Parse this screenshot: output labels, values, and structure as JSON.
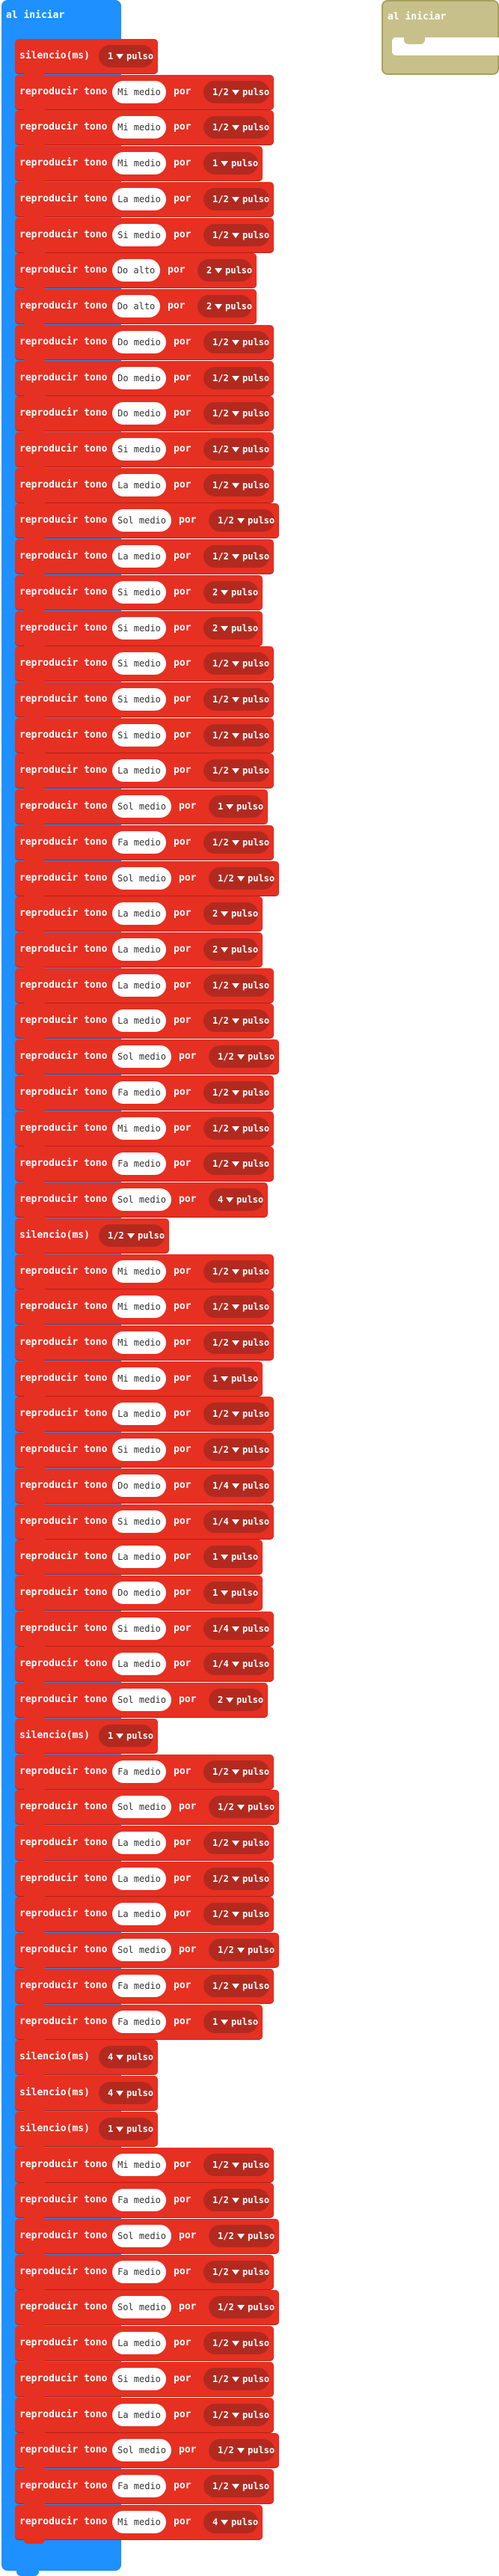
{
  "hat": {
    "title": "al iniciar"
  },
  "ghost": {
    "title": "al iniciar"
  },
  "labels": {
    "play": "reproducir tono",
    "por": "por",
    "rest": "silencio(ms)",
    "unit": "pulso"
  },
  "colors": {
    "hat_blue": "#1e90ff",
    "music_red": "#e63022",
    "dropdown_dark_red": "#b22a1f",
    "ghost_khaki": "#c7c08a"
  },
  "blocks": [
    {
      "type": "rest",
      "beat": "1"
    },
    {
      "type": "play",
      "note": "Mi medio",
      "beat": "1/2"
    },
    {
      "type": "play",
      "note": "Mi medio",
      "beat": "1/2"
    },
    {
      "type": "play",
      "note": "Mi medio",
      "beat": "1"
    },
    {
      "type": "play",
      "note": "La medio",
      "beat": "1/2"
    },
    {
      "type": "play",
      "note": "Si medio",
      "beat": "1/2"
    },
    {
      "type": "play",
      "note": "Do alto",
      "beat": "2"
    },
    {
      "type": "play",
      "note": "Do alto",
      "beat": "2"
    },
    {
      "type": "play",
      "note": "Do medio",
      "beat": "1/2"
    },
    {
      "type": "play",
      "note": "Do medio",
      "beat": "1/2"
    },
    {
      "type": "play",
      "note": "Do medio",
      "beat": "1/2"
    },
    {
      "type": "play",
      "note": "Si medio",
      "beat": "1/2"
    },
    {
      "type": "play",
      "note": "La medio",
      "beat": "1/2"
    },
    {
      "type": "play",
      "note": "Sol medio",
      "beat": "1/2"
    },
    {
      "type": "play",
      "note": "La medio",
      "beat": "1/2"
    },
    {
      "type": "play",
      "note": "Si medio",
      "beat": "2"
    },
    {
      "type": "play",
      "note": "Si medio",
      "beat": "2"
    },
    {
      "type": "play",
      "note": "Si medio",
      "beat": "1/2"
    },
    {
      "type": "play",
      "note": "Si medio",
      "beat": "1/2"
    },
    {
      "type": "play",
      "note": "Si medio",
      "beat": "1/2"
    },
    {
      "type": "play",
      "note": "La medio",
      "beat": "1/2"
    },
    {
      "type": "play",
      "note": "Sol medio",
      "beat": "1"
    },
    {
      "type": "play",
      "note": "Fa medio",
      "beat": "1/2"
    },
    {
      "type": "play",
      "note": "Sol medio",
      "beat": "1/2"
    },
    {
      "type": "play",
      "note": "La medio",
      "beat": "2"
    },
    {
      "type": "play",
      "note": "La medio",
      "beat": "2"
    },
    {
      "type": "play",
      "note": "La medio",
      "beat": "1/2"
    },
    {
      "type": "play",
      "note": "La medio",
      "beat": "1/2"
    },
    {
      "type": "play",
      "note": "Sol medio",
      "beat": "1/2"
    },
    {
      "type": "play",
      "note": "Fa medio",
      "beat": "1/2"
    },
    {
      "type": "play",
      "note": "Mi medio",
      "beat": "1/2"
    },
    {
      "type": "play",
      "note": "Fa medio",
      "beat": "1/2"
    },
    {
      "type": "play",
      "note": "Sol medio",
      "beat": "4"
    },
    {
      "type": "rest",
      "beat": "1/2"
    },
    {
      "type": "play",
      "note": "Mi medio",
      "beat": "1/2"
    },
    {
      "type": "play",
      "note": "Mi medio",
      "beat": "1/2"
    },
    {
      "type": "play",
      "note": "Mi medio",
      "beat": "1/2"
    },
    {
      "type": "play",
      "note": "Mi medio",
      "beat": "1"
    },
    {
      "type": "play",
      "note": "La medio",
      "beat": "1/2"
    },
    {
      "type": "play",
      "note": "Si medio",
      "beat": "1/2"
    },
    {
      "type": "play",
      "note": "Do medio",
      "beat": "1/4"
    },
    {
      "type": "play",
      "note": "Si medio",
      "beat": "1/4"
    },
    {
      "type": "play",
      "note": "La medio",
      "beat": "1"
    },
    {
      "type": "play",
      "note": "Do medio",
      "beat": "1"
    },
    {
      "type": "play",
      "note": "Si medio",
      "beat": "1/4"
    },
    {
      "type": "play",
      "note": "La medio",
      "beat": "1/4"
    },
    {
      "type": "play",
      "note": "Sol medio",
      "beat": "2"
    },
    {
      "type": "rest",
      "beat": "1"
    },
    {
      "type": "play",
      "note": "Fa medio",
      "beat": "1/2"
    },
    {
      "type": "play",
      "note": "Sol medio",
      "beat": "1/2"
    },
    {
      "type": "play",
      "note": "La medio",
      "beat": "1/2"
    },
    {
      "type": "play",
      "note": "La medio",
      "beat": "1/2"
    },
    {
      "type": "play",
      "note": "La medio",
      "beat": "1/2"
    },
    {
      "type": "play",
      "note": "Sol medio",
      "beat": "1/2"
    },
    {
      "type": "play",
      "note": "Fa medio",
      "beat": "1/2"
    },
    {
      "type": "play",
      "note": "Fa medio",
      "beat": "1"
    },
    {
      "type": "rest",
      "beat": "4"
    },
    {
      "type": "rest",
      "beat": "4"
    },
    {
      "type": "rest",
      "beat": "1"
    },
    {
      "type": "play",
      "note": "Mi medio",
      "beat": "1/2"
    },
    {
      "type": "play",
      "note": "Fa medio",
      "beat": "1/2"
    },
    {
      "type": "play",
      "note": "Sol medio",
      "beat": "1/2"
    },
    {
      "type": "play",
      "note": "Fa medio",
      "beat": "1/2"
    },
    {
      "type": "play",
      "note": "Sol medio",
      "beat": "1/2"
    },
    {
      "type": "play",
      "note": "La medio",
      "beat": "1/2"
    },
    {
      "type": "play",
      "note": "Si medio",
      "beat": "1/2"
    },
    {
      "type": "play",
      "note": "La medio",
      "beat": "1/2"
    },
    {
      "type": "play",
      "note": "Sol medio",
      "beat": "1/2"
    },
    {
      "type": "play",
      "note": "Fa medio",
      "beat": "1/2"
    },
    {
      "type": "play",
      "note": "Mi medio",
      "beat": "4"
    }
  ]
}
